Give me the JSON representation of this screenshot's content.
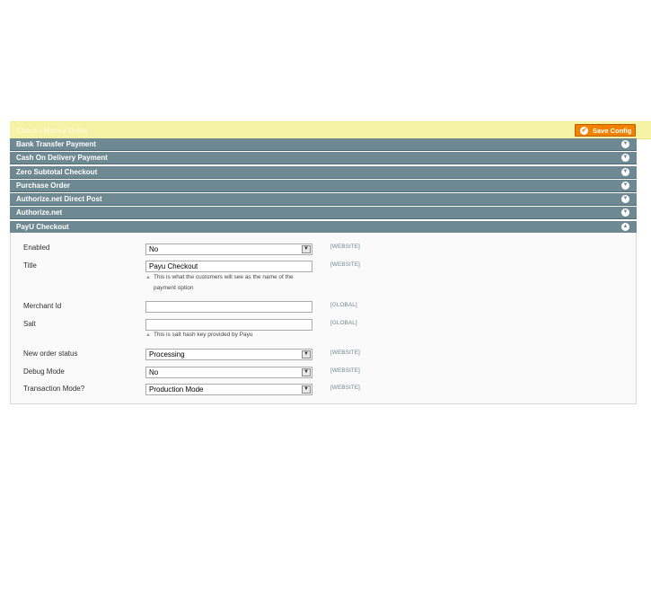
{
  "highlight": {
    "title": "Check / Money Order",
    "save_label": "Save Config"
  },
  "sections": [
    {
      "label": "Bank Transfer Payment",
      "state": "collapsed"
    },
    {
      "label": "Cash On Delivery Payment",
      "state": "collapsed"
    },
    {
      "label": "Zero Subtotal Checkout",
      "state": "collapsed"
    },
    {
      "label": "Purchase Order",
      "state": "collapsed"
    },
    {
      "label": "Authorize.net Direct Post",
      "state": "collapsed"
    },
    {
      "label": "Authorize.net",
      "state": "collapsed"
    },
    {
      "label": "PayU Checkout",
      "state": "expanded"
    }
  ],
  "form": {
    "enabled": {
      "label": "Enabled",
      "value": "No",
      "scope": "[WEBSITE]"
    },
    "title": {
      "label": "Title",
      "value": "Payu Checkout",
      "scope": "[WEBSITE]",
      "note_line1": "This is what the customers will see as the name of the",
      "note_line2": "payment option"
    },
    "merchant_id": {
      "label": "Merchant Id",
      "value": "",
      "scope": "[GLOBAL]"
    },
    "salt": {
      "label": "Salt",
      "value": "",
      "scope": "[GLOBAL]",
      "note": "This is salt hash key provided by Payu"
    },
    "new_order_status": {
      "label": "New order status",
      "value": "Processing",
      "scope": "[WEBSITE]"
    },
    "debug_mode": {
      "label": "Debug Mode",
      "value": "No",
      "scope": "[WEBSITE]"
    },
    "transaction_mode": {
      "label": "Transaction Mode?",
      "value": "Production Mode",
      "scope": "[WEBSITE]"
    }
  },
  "icons": {
    "collapsed": "chevron-down-icon",
    "expanded": "chevron-up-icon",
    "save": "checkmark-icon",
    "dropdown": "dropdown-arrow-icon"
  },
  "colors": {
    "highlight": "#f6f3a6",
    "save_button": "#f18200",
    "section_header": "#6f8992"
  }
}
